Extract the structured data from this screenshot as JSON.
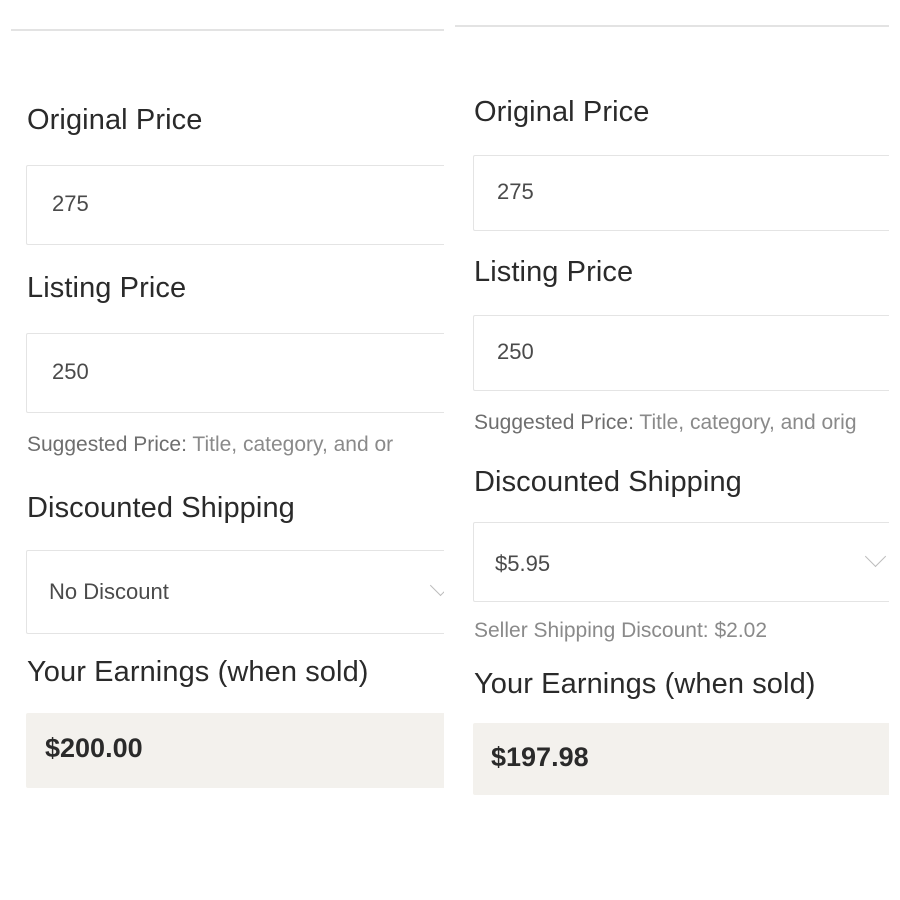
{
  "panels": [
    {
      "original_price": {
        "label": "Original Price",
        "value": "275"
      },
      "listing_price": {
        "label": "Listing Price",
        "value": "250"
      },
      "suggested_price": {
        "label": "Suggested Price:",
        "text": "Title, category, and or"
      },
      "discounted_shipping": {
        "label": "Discounted Shipping",
        "selected": "No Discount",
        "icon": "chevron-down-icon"
      },
      "earnings": {
        "label": "Your Earnings (when sold)",
        "value": "$200.00"
      }
    },
    {
      "original_price": {
        "label": "Original Price",
        "value": "275"
      },
      "listing_price": {
        "label": "Listing Price",
        "value": "250"
      },
      "suggested_price": {
        "label": "Suggested Price:",
        "text": "Title, category, and orig"
      },
      "discounted_shipping": {
        "label": "Discounted Shipping",
        "selected": "$5.95",
        "icon": "chevron-down-icon"
      },
      "seller_shipping_discount": "Seller Shipping Discount: $2.02",
      "earnings": {
        "label": "Your Earnings (when sold)",
        "value": "$197.98"
      }
    }
  ],
  "colors": {
    "earnings_background": "#f3f1ed",
    "hint_text": "#8a8a8a",
    "label_text": "#2a2a2a"
  }
}
